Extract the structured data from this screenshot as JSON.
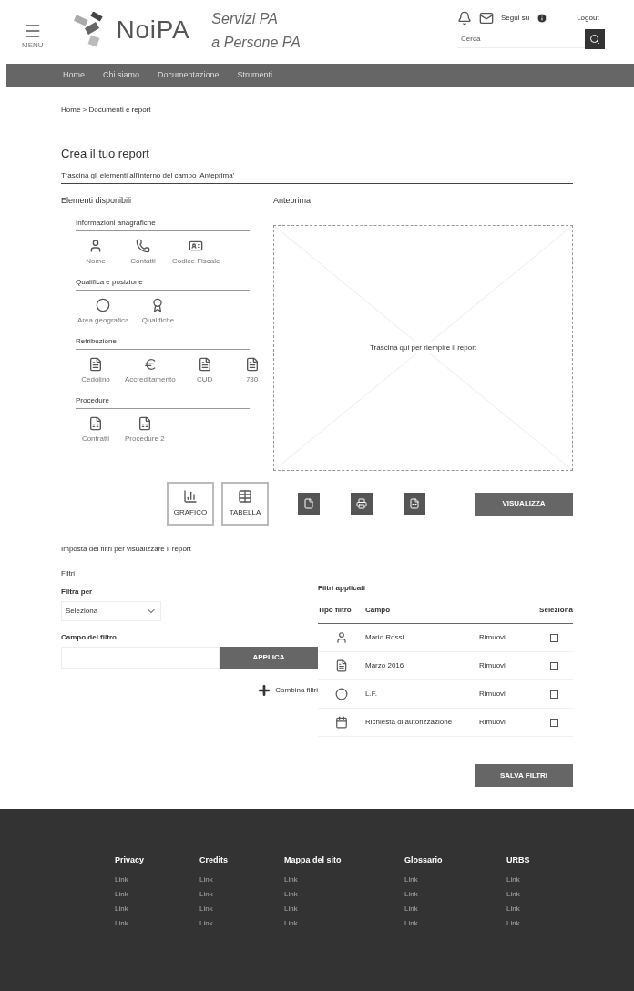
{
  "header": {
    "menu_label": "MENU",
    "logo_text": "NoiPA",
    "tagline_lines": [
      "Servizi PA",
      "a Persone PA"
    ],
    "follow_label": "Segui su",
    "logout": "Logout",
    "search": {
      "placeholder": "Cerca"
    }
  },
  "nav": [
    "Home",
    "Chi siamo",
    "Documentazione",
    "Strumenti"
  ],
  "breadcrumb": "Home > Documenti e report",
  "title": "Crea il tuo report",
  "instructions": "Trascina gli elementi all'interno del campo 'Anteprima'",
  "elements": {
    "title": "Elementi disponibili",
    "groups": [
      {
        "title": "Informazioni anagrafiche",
        "items": [
          {
            "kind": "user",
            "label": "Nome"
          },
          {
            "kind": "phone",
            "label": "Contatti"
          },
          {
            "kind": "card",
            "label": "Codice Fiscale"
          }
        ]
      },
      {
        "title": "Qualifica e posizione",
        "items": [
          {
            "kind": "circle",
            "label": "Area geografica"
          },
          {
            "kind": "badge",
            "label": "Qualifiche"
          }
        ]
      },
      {
        "title": "Retribuzione",
        "items": [
          {
            "kind": "file",
            "label": "Cedolino"
          },
          {
            "kind": "euro",
            "label": "Accreditamento"
          },
          {
            "kind": "file",
            "label": "CUD"
          },
          {
            "kind": "file",
            "label": "730"
          }
        ]
      },
      {
        "title": "Procedure",
        "items": [
          {
            "kind": "doc",
            "label": "Contratti"
          },
          {
            "kind": "doc",
            "label": "Procedure 2"
          }
        ]
      }
    ]
  },
  "preview": {
    "title": "Anteprima",
    "hint": "Trascina qui per riempire il report"
  },
  "view_buttons": [
    {
      "kind": "chart",
      "label": "GRAFICO"
    },
    {
      "kind": "table",
      "label": "TABELLA"
    }
  ],
  "export_buttons": [
    {
      "kind": "pdf"
    },
    {
      "kind": "print"
    },
    {
      "kind": "excel"
    }
  ],
  "visualize": "VISUALIZZA",
  "filters_heading": "Imposta dei filtri per visualizzare il report",
  "filters": {
    "title": "Filtri",
    "filter_by_label": "Filtra per",
    "filter_by_value": "Seleziona",
    "field_label": "Campo del filtro",
    "apply": "APPLICA",
    "combine": "Combina filtri"
  },
  "applied": {
    "title": "Filtri applicati",
    "columns": [
      "Tipo filtro",
      "Campo",
      "Seleziona"
    ],
    "rows": [
      {
        "kind": "user",
        "value": "Mario Rossi",
        "action": "Rimuovi",
        "checked": false
      },
      {
        "kind": "file",
        "value": "Marzo 2016",
        "action": "Rimuovi",
        "checked": false
      },
      {
        "kind": "circle",
        "value": "L.F.",
        "action": "Rimuovi",
        "checked": false
      },
      {
        "kind": "calendar",
        "value": "Richiesta di autorizzazione",
        "action": "Rimuovi",
        "checked": false
      }
    ]
  },
  "save": "SALVA FILTRI",
  "footer": [
    {
      "title": "Privacy",
      "links": [
        "Link",
        "Link",
        "Link",
        "Link"
      ]
    },
    {
      "title": "Credits",
      "links": [
        "Link",
        "Link",
        "Link",
        "Link"
      ]
    },
    {
      "title": "Mappa del sito",
      "links": [
        "Link",
        "Link",
        "Link",
        "Link"
      ]
    },
    {
      "title": "Glossario",
      "links": [
        "Link",
        "Link",
        "Link",
        "Link"
      ]
    },
    {
      "title": "URBS",
      "links": [
        "Link",
        "Link",
        "Link",
        "Link"
      ]
    }
  ]
}
